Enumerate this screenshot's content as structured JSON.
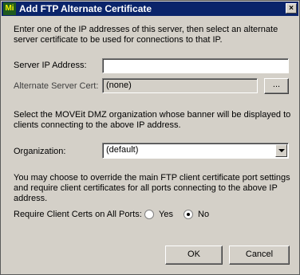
{
  "window": {
    "title": "Add FTP Alternate Certificate",
    "icon_text": "Mi",
    "close_glyph": "×"
  },
  "intro": {
    "line1": "Enter one of the IP addresses of this server, then select an alternate",
    "line2": "server certificate to be used for connections to that IP."
  },
  "server_ip": {
    "label": "Server IP Address:",
    "value": ""
  },
  "alt_cert": {
    "label": "Alternate Server Cert:",
    "value": "(none)",
    "browse_label": "..."
  },
  "org_intro": {
    "line1": "Select the MOVEit DMZ organization whose banner will be displayed to",
    "line2": "clients connecting to the above IP address."
  },
  "organization": {
    "label": "Organization:",
    "value": "(default)"
  },
  "override_intro": {
    "line1": "You may choose to override the main FTP client certificate port settings",
    "line2": "and require client certificates for all ports connecting to the above IP",
    "line3": "address."
  },
  "require_certs": {
    "label": "Require Client Certs on All Ports:",
    "yes_label": "Yes",
    "no_label": "No",
    "selected": "No"
  },
  "buttons": {
    "ok_label": "OK",
    "cancel_label": "Cancel"
  }
}
